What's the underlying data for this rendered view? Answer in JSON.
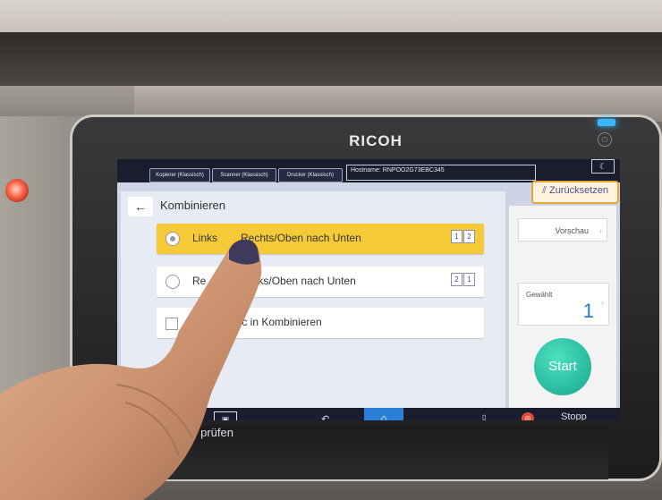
{
  "device": {
    "brand": "RICOH"
  },
  "topbar": {
    "tabs": [
      "Kopierer (Klassisch)",
      "Scanner (Klassisch)",
      "Drucker (Klassisch)"
    ],
    "hostname": "Hostname: RNPOO2G73EBC345",
    "reset_label": "Zurücksetzen"
  },
  "page": {
    "title": "Kombinieren"
  },
  "options": [
    {
      "label": "Links",
      "label_tail": "Rechts/Oben nach Unten",
      "badge": [
        "1",
        "2"
      ],
      "selected": true
    },
    {
      "label": "Re",
      "label_tail": "ch Links/Oben nach Unten",
      "badge": [
        "2",
        "1"
      ],
      "selected": false
    }
  ],
  "checkbox_option": {
    "label": "nic in Kombinieren"
  },
  "side_panel": {
    "preview_label": "Vorschau",
    "selected_label": "Gewählt",
    "selected_count": "1",
    "start_label": "Start"
  },
  "bottombar": {
    "check_label": "s prüfen",
    "stop_label": "Stopp"
  },
  "colors": {
    "selected_option": "#f6c936",
    "start_button": "#1fb89a",
    "accent_blue": "#1a7bd8",
    "reset_border": "#e6a43a"
  }
}
